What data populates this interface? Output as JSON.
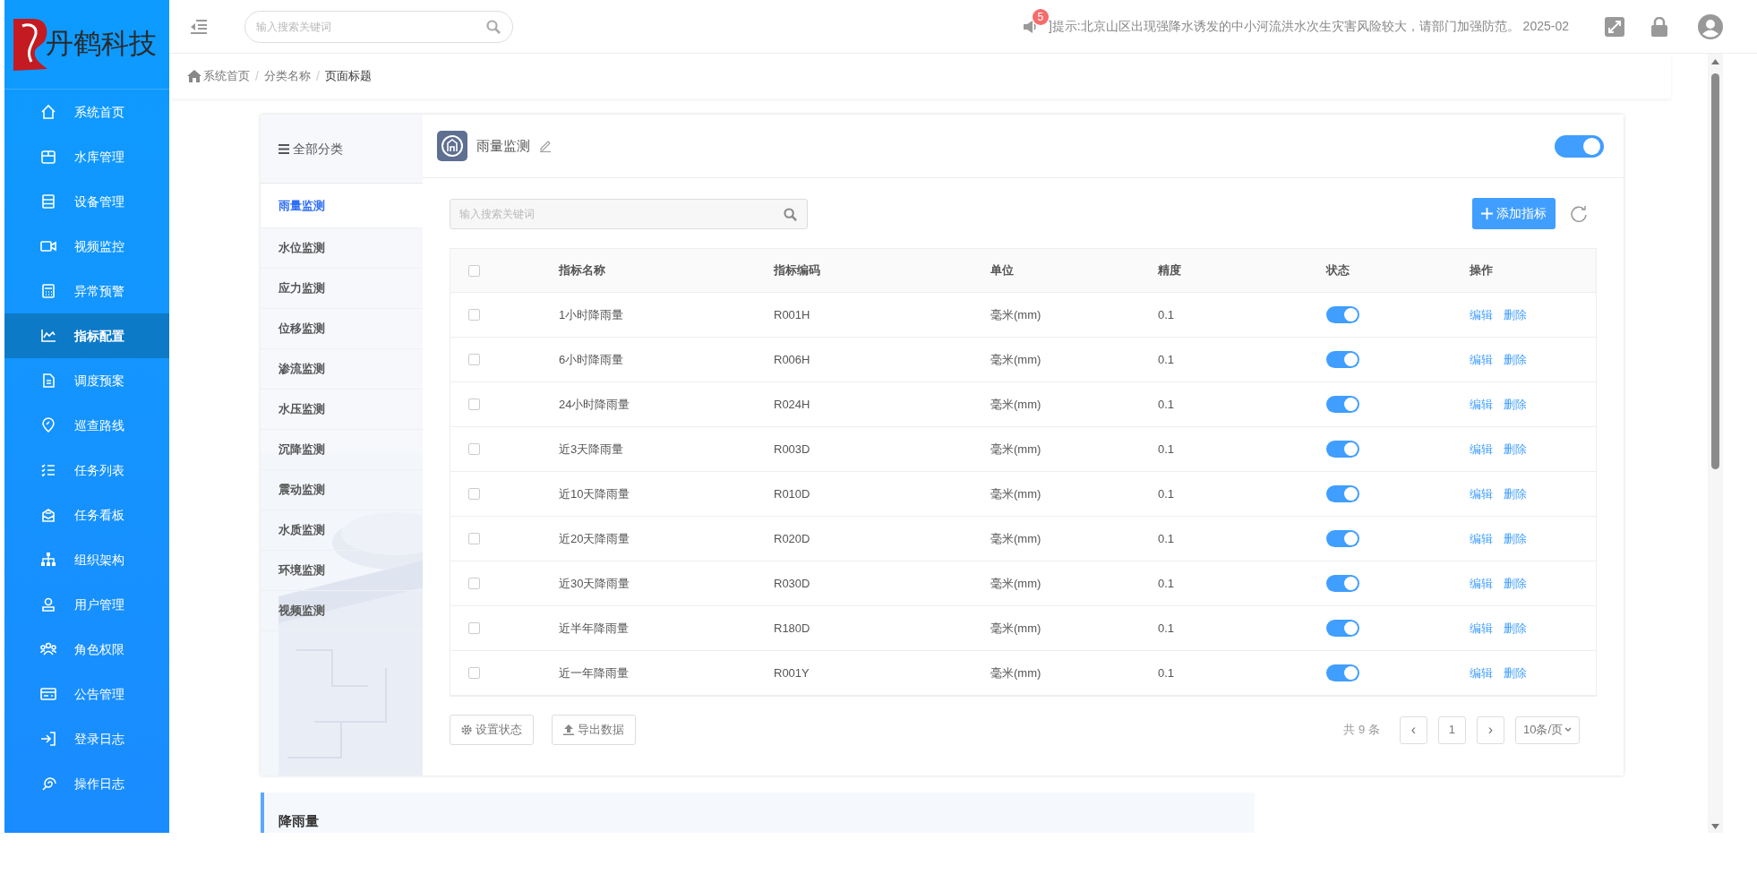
{
  "logo": {
    "text": "丹鹤科技"
  },
  "search": {
    "placeholder": "输入搜索关键词"
  },
  "notice": {
    "badge": "5",
    "text": "]提示:北京山区出现强降水诱发的中小河流洪水次生灾害风险较大，请部门加强防范。 2025-02"
  },
  "breadcrumb": {
    "separator": "/",
    "items": [
      "系统首页",
      "分类名称",
      "页面标题"
    ]
  },
  "sidebar": {
    "items": [
      {
        "label": "系统首页",
        "selected": false
      },
      {
        "label": "水库管理",
        "selected": false
      },
      {
        "label": "设备管理",
        "selected": false
      },
      {
        "label": "视频监控",
        "selected": false
      },
      {
        "label": "异常预警",
        "selected": false
      },
      {
        "label": "指标配置",
        "selected": true
      },
      {
        "label": "调度预案",
        "selected": false
      },
      {
        "label": "巡查路线",
        "selected": false
      },
      {
        "label": "任务列表",
        "selected": false
      },
      {
        "label": "任务看板",
        "selected": false
      },
      {
        "label": "组织架构",
        "selected": false
      },
      {
        "label": "用户管理",
        "selected": false
      },
      {
        "label": "角色权限",
        "selected": false
      },
      {
        "label": "公告管理",
        "selected": false
      },
      {
        "label": "登录日志",
        "selected": false
      },
      {
        "label": "操作日志",
        "selected": false
      }
    ]
  },
  "categories": {
    "title": "全部分类",
    "items": [
      {
        "label": "雨量监测",
        "selected": true
      },
      {
        "label": "水位监测",
        "selected": false
      },
      {
        "label": "应力监测",
        "selected": false
      },
      {
        "label": "位移监测",
        "selected": false
      },
      {
        "label": "渗流监测",
        "selected": false
      },
      {
        "label": "水压监测",
        "selected": false
      },
      {
        "label": "沉降监测",
        "selected": false
      },
      {
        "label": "震动监测",
        "selected": false
      },
      {
        "label": "水质监测",
        "selected": false
      },
      {
        "label": "环境监测",
        "selected": false
      },
      {
        "label": "视频监测",
        "selected": false
      }
    ]
  },
  "panel": {
    "title": "雨量监测",
    "enabled": true,
    "search_placeholder": "输入搜索关键词",
    "add_button": "添加指标"
  },
  "table": {
    "columns": [
      "指标名称",
      "指标编码",
      "单位",
      "精度",
      "状态",
      "操作"
    ],
    "header_checked": false,
    "rows": [
      {
        "checked": false,
        "name": "1小时降雨量",
        "code": "R001H",
        "unit": "毫米(mm)",
        "precision": "0.1",
        "on": true,
        "actions": [
          "编辑",
          "删除"
        ]
      },
      {
        "checked": false,
        "name": "6小时降雨量",
        "code": "R006H",
        "unit": "毫米(mm)",
        "precision": "0.1",
        "on": true,
        "actions": [
          "编辑",
          "删除"
        ]
      },
      {
        "checked": false,
        "name": "24小时降雨量",
        "code": "R024H",
        "unit": "毫米(mm)",
        "precision": "0.1",
        "on": true,
        "actions": [
          "编辑",
          "删除"
        ]
      },
      {
        "checked": false,
        "name": "近3天降雨量",
        "code": "R003D",
        "unit": "毫米(mm)",
        "precision": "0.1",
        "on": true,
        "actions": [
          "编辑",
          "删除"
        ]
      },
      {
        "checked": false,
        "name": "近10天降雨量",
        "code": "R010D",
        "unit": "毫米(mm)",
        "precision": "0.1",
        "on": true,
        "actions": [
          "编辑",
          "删除"
        ]
      },
      {
        "checked": false,
        "name": "近20天降雨量",
        "code": "R020D",
        "unit": "毫米(mm)",
        "precision": "0.1",
        "on": true,
        "actions": [
          "编辑",
          "删除"
        ]
      },
      {
        "checked": false,
        "name": "近30天降雨量",
        "code": "R030D",
        "unit": "毫米(mm)",
        "precision": "0.1",
        "on": true,
        "actions": [
          "编辑",
          "删除"
        ]
      },
      {
        "checked": false,
        "name": "近半年降雨量",
        "code": "R180D",
        "unit": "毫米(mm)",
        "precision": "0.1",
        "on": true,
        "actions": [
          "编辑",
          "删除"
        ]
      },
      {
        "checked": false,
        "name": "近一年降雨量",
        "code": "R001Y",
        "unit": "毫米(mm)",
        "precision": "0.1",
        "on": true,
        "actions": [
          "编辑",
          "删除"
        ]
      }
    ]
  },
  "footer": {
    "buttons": [
      "设置状态",
      "导出数据"
    ],
    "total": "共 9 条",
    "prev": "‹",
    "page": "1",
    "next": "›",
    "page_size": "10条/页"
  },
  "section": {
    "title": "降雨量"
  }
}
